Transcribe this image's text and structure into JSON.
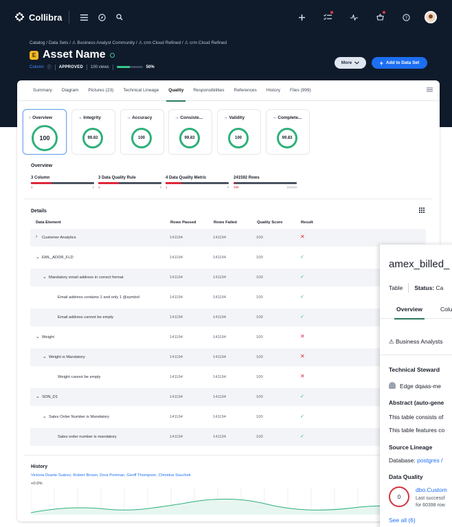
{
  "nav": {
    "brand": "Collibra"
  },
  "breadcrumb": "Catalog / Data Sets / ⚠ Business Analyst Community / ⚠ crm Cloud Refined / ⚠ crm Cloud Refined",
  "asset": {
    "icon_letter": "E",
    "title": "Asset Name",
    "type": "Column",
    "status": "APPROVED",
    "views": "100 views",
    "progress_label": "50%",
    "progress": 0.5
  },
  "actions": {
    "more": "More",
    "add": "Add to Data Set"
  },
  "tabs": [
    "Summary",
    "Diagram",
    "Pictures (23)",
    "Technical Lineage",
    "Quality",
    "Responsibilities",
    "References",
    "History",
    "Files (999)"
  ],
  "active_tab": "Quality",
  "dimensions": [
    {
      "label": "Overview",
      "score": "100",
      "active": true
    },
    {
      "label": "Integrity",
      "score": "99.83",
      "active": false
    },
    {
      "label": "Accuracy",
      "score": "100",
      "active": false
    },
    {
      "label": "Consiste...",
      "score": "99.83",
      "active": false
    },
    {
      "label": "Validity",
      "score": "100",
      "active": false
    },
    {
      "label": "Complete...",
      "score": "99.83",
      "active": false
    }
  ],
  "overview": {
    "title": "Overview",
    "items": [
      {
        "label": "3 Column",
        "left": "1",
        "right": "2",
        "red_fraction": 0.33,
        "left_bad": false
      },
      {
        "label": "3 Data Quality Rule",
        "left": "1",
        "right": "2",
        "red_fraction": 0.33,
        "left_bad": false
      },
      {
        "label": "4 Data Quality Metric",
        "left": "1",
        "right": "3",
        "red_fraction": 0.25,
        "left_bad": false
      },
      {
        "label": "241592 Rows",
        "left": "488",
        "right": "241104",
        "red_fraction": 0.02,
        "left_bad": true
      }
    ]
  },
  "details": {
    "title": "Details",
    "columns": [
      "Data Element",
      "Rows Passed",
      "Rows Failed",
      "Quality Score",
      "Result"
    ],
    "rows": [
      {
        "chevron": "›",
        "name": "Customer Analytics",
        "passed": "141194",
        "failed": "141194",
        "score": "100",
        "result": "fail",
        "indent": 0
      },
      {
        "chevron": "⌄",
        "name": "EML_ADDR_FLD",
        "passed": "141194",
        "failed": "141194",
        "score": "100",
        "result": "pass",
        "indent": 0
      },
      {
        "chevron": "⌄",
        "name": "Mandatory email address in correct format",
        "passed": "141194",
        "failed": "141194",
        "score": "100",
        "result": "pass",
        "indent": 1
      },
      {
        "chevron": "",
        "name": "Email address contains 1 and only 1 @symbol",
        "passed": "141194",
        "failed": "141194",
        "score": "100",
        "result": "pass",
        "indent": 2
      },
      {
        "chevron": "",
        "name": "Email address cannot be empty",
        "passed": "141194",
        "failed": "141194",
        "score": "100",
        "result": "pass",
        "indent": 2
      },
      {
        "chevron": "⌄",
        "name": "Weight",
        "passed": "141194",
        "failed": "141194",
        "score": "100",
        "result": "fail",
        "indent": 0
      },
      {
        "chevron": "⌄",
        "name": "Weight is Mandatory",
        "passed": "141194",
        "failed": "141194",
        "score": "100",
        "result": "fail",
        "indent": 1
      },
      {
        "chevron": "",
        "name": "Weight cannot be empty",
        "passed": "141194",
        "failed": "141194",
        "score": "100",
        "result": "fail",
        "indent": 2
      },
      {
        "chevron": "⌄",
        "name": "SON_D1",
        "passed": "141194",
        "failed": "141194",
        "score": "100",
        "result": "pass",
        "indent": 0
      },
      {
        "chevron": "⌄",
        "name": "Sales Order Number is Mandatory",
        "passed": "141194",
        "failed": "141194",
        "score": "100",
        "result": "pass",
        "indent": 1
      },
      {
        "chevron": "",
        "name": "Sales order number is mandatory",
        "passed": "141194",
        "failed": "141194",
        "score": "100",
        "result": "pass",
        "indent": 2
      }
    ]
  },
  "history": {
    "title": "History",
    "names": "Victoria Duarte Suárez, Robert Brown, Dora Portman, Geoff Thompson, Christina Souchek",
    "pct": "+0.0%"
  },
  "panel": {
    "title": "amex_billed_",
    "type": "Table",
    "status_label": "Status:",
    "status_value": "Ca",
    "tab_overview": "Overview",
    "tab_columns": "Colu",
    "community": "⚠ Business Analysts",
    "steward_title": "Technical Steward",
    "steward_name": "Edge dqaas-me",
    "abstract_title": "Abstract (auto-gene",
    "abstract_line1": "This table consists of",
    "abstract_line2": "This table features co",
    "lineage_title": "Source Lineage",
    "lineage_label": "Database:",
    "lineage_value": "postgres /",
    "dq_title": "Data Quality",
    "dq_score": "0",
    "dq_link": "dbo.Custom",
    "dq_sub1": "Last successf",
    "dq_sub2": "for 60398 row",
    "see_all": "See all (6)"
  },
  "colors": {
    "navy": "#0f1b2b",
    "accent_blue": "#1d6ff2",
    "green": "#2db07a",
    "red": "#e0253a"
  }
}
